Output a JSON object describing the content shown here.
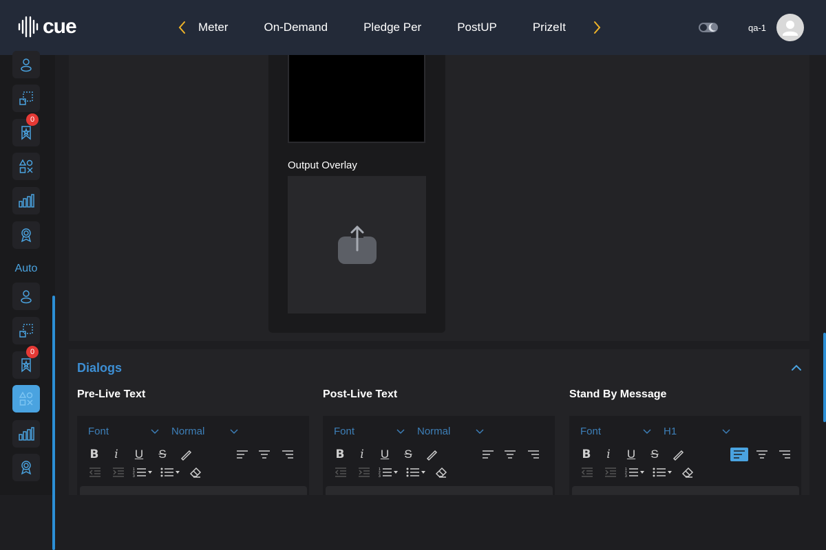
{
  "header": {
    "logo_text": "cue",
    "nav_items": [
      "Meter",
      "On-Demand",
      "Pledge Per",
      "PostUP",
      "PrizeIt"
    ],
    "user_name": "qa-1"
  },
  "sidebar": {
    "section_label": "Auto",
    "badge_count_1": "0",
    "badge_count_2": "0"
  },
  "content": {
    "output_overlay_label": "Output Overlay"
  },
  "dialogs": {
    "title": "Dialogs",
    "columns": [
      {
        "title": "Pre-Live Text",
        "font_placeholder": "Font",
        "size_value": "Normal"
      },
      {
        "title": "Post-Live Text",
        "font_placeholder": "Font",
        "size_value": "Normal"
      },
      {
        "title": "Stand By Message",
        "font_placeholder": "Font",
        "size_value": "H1"
      }
    ]
  },
  "colors": {
    "accent": "#4aa3e0",
    "header_bg": "#232a38",
    "badge": "#e53935",
    "arrow": "#f0b429"
  },
  "icons": {
    "sidebar_icons": [
      "user-icon",
      "crop-icon",
      "bookmark-star-icon",
      "shapes-icon",
      "bar-chart-icon",
      "award-icon"
    ]
  }
}
